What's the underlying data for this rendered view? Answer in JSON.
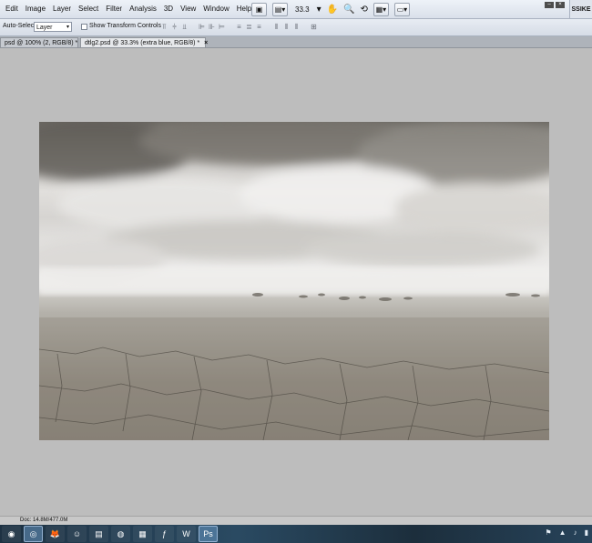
{
  "menubar": {
    "items": [
      "Edit",
      "Image",
      "Layer",
      "Select",
      "Filter",
      "Analysis",
      "3D",
      "View",
      "Window",
      "Help"
    ],
    "zoom_level": "33.3",
    "workspace_badge": "SSIKE"
  },
  "options": {
    "auto_select_label": "Auto-Select:",
    "layer_select_value": "Layer",
    "show_transform_label": "Show Transform Controls"
  },
  "tabs": [
    {
      "label": "psd @ 100% (2, RGB/8) *",
      "active": false
    },
    {
      "label": "dtlg2.psd @ 33.3% (extra blue, RGB/8) *",
      "active": true
    }
  ],
  "status": {
    "doc_info": "Doc: 14.8M/477.0M"
  },
  "colors": {
    "workspace": "#bdbdbd",
    "menubar": "#dde3ec",
    "taskbar": "#1f3447"
  }
}
